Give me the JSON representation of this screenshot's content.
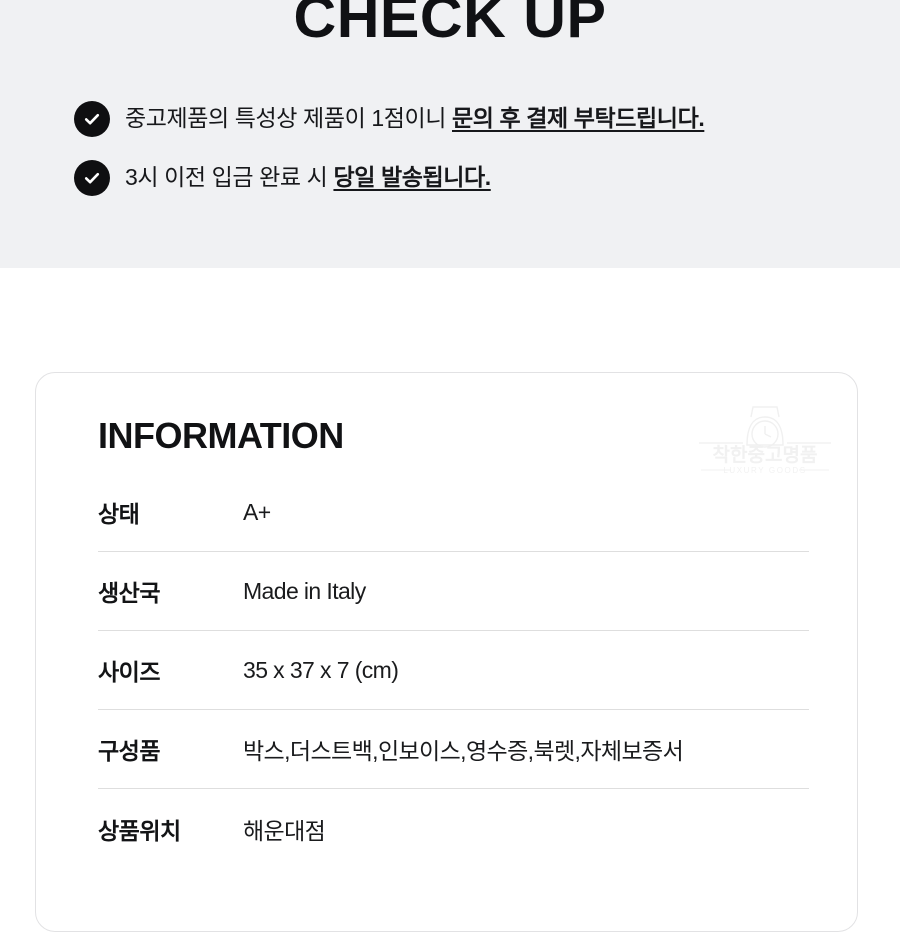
{
  "checkup": {
    "title": "CHECK UP",
    "items": [
      {
        "icon": "check-circle-icon",
        "text_plain": "중고제품의 특성상 제품이 1점이니 ",
        "text_emphasis": "문의 후 결제 부탁드립니다."
      },
      {
        "icon": "check-circle-icon",
        "text_plain": "3시 이전 입금 완료 시 ",
        "text_emphasis": "당일 발송됩니다."
      }
    ]
  },
  "information": {
    "title": "INFORMATION",
    "watermark": {
      "icon": "watch-icon",
      "brand_kr": "착한중고명품",
      "brand_en": "LUXURY GOODS"
    },
    "rows": [
      {
        "label": "상태",
        "value": "A+"
      },
      {
        "label": "생산국",
        "value": "Made in Italy"
      },
      {
        "label": "사이즈",
        "value": "35 x 37 x 7 (cm)"
      },
      {
        "label": "구성품",
        "value": "박스,더스트백,인보이스,영수증,북렛,자체보증서"
      },
      {
        "label": "상품위치",
        "value": "해운대점"
      }
    ]
  },
  "colors": {
    "page_background": "#ffffff",
    "section_background": "#f0f1f3",
    "text_primary": "#111214",
    "badge_fill": "#0f0f11",
    "divider": "#dedede",
    "card_border": "#e2e2e4",
    "watermark": "#f2f2f2"
  }
}
